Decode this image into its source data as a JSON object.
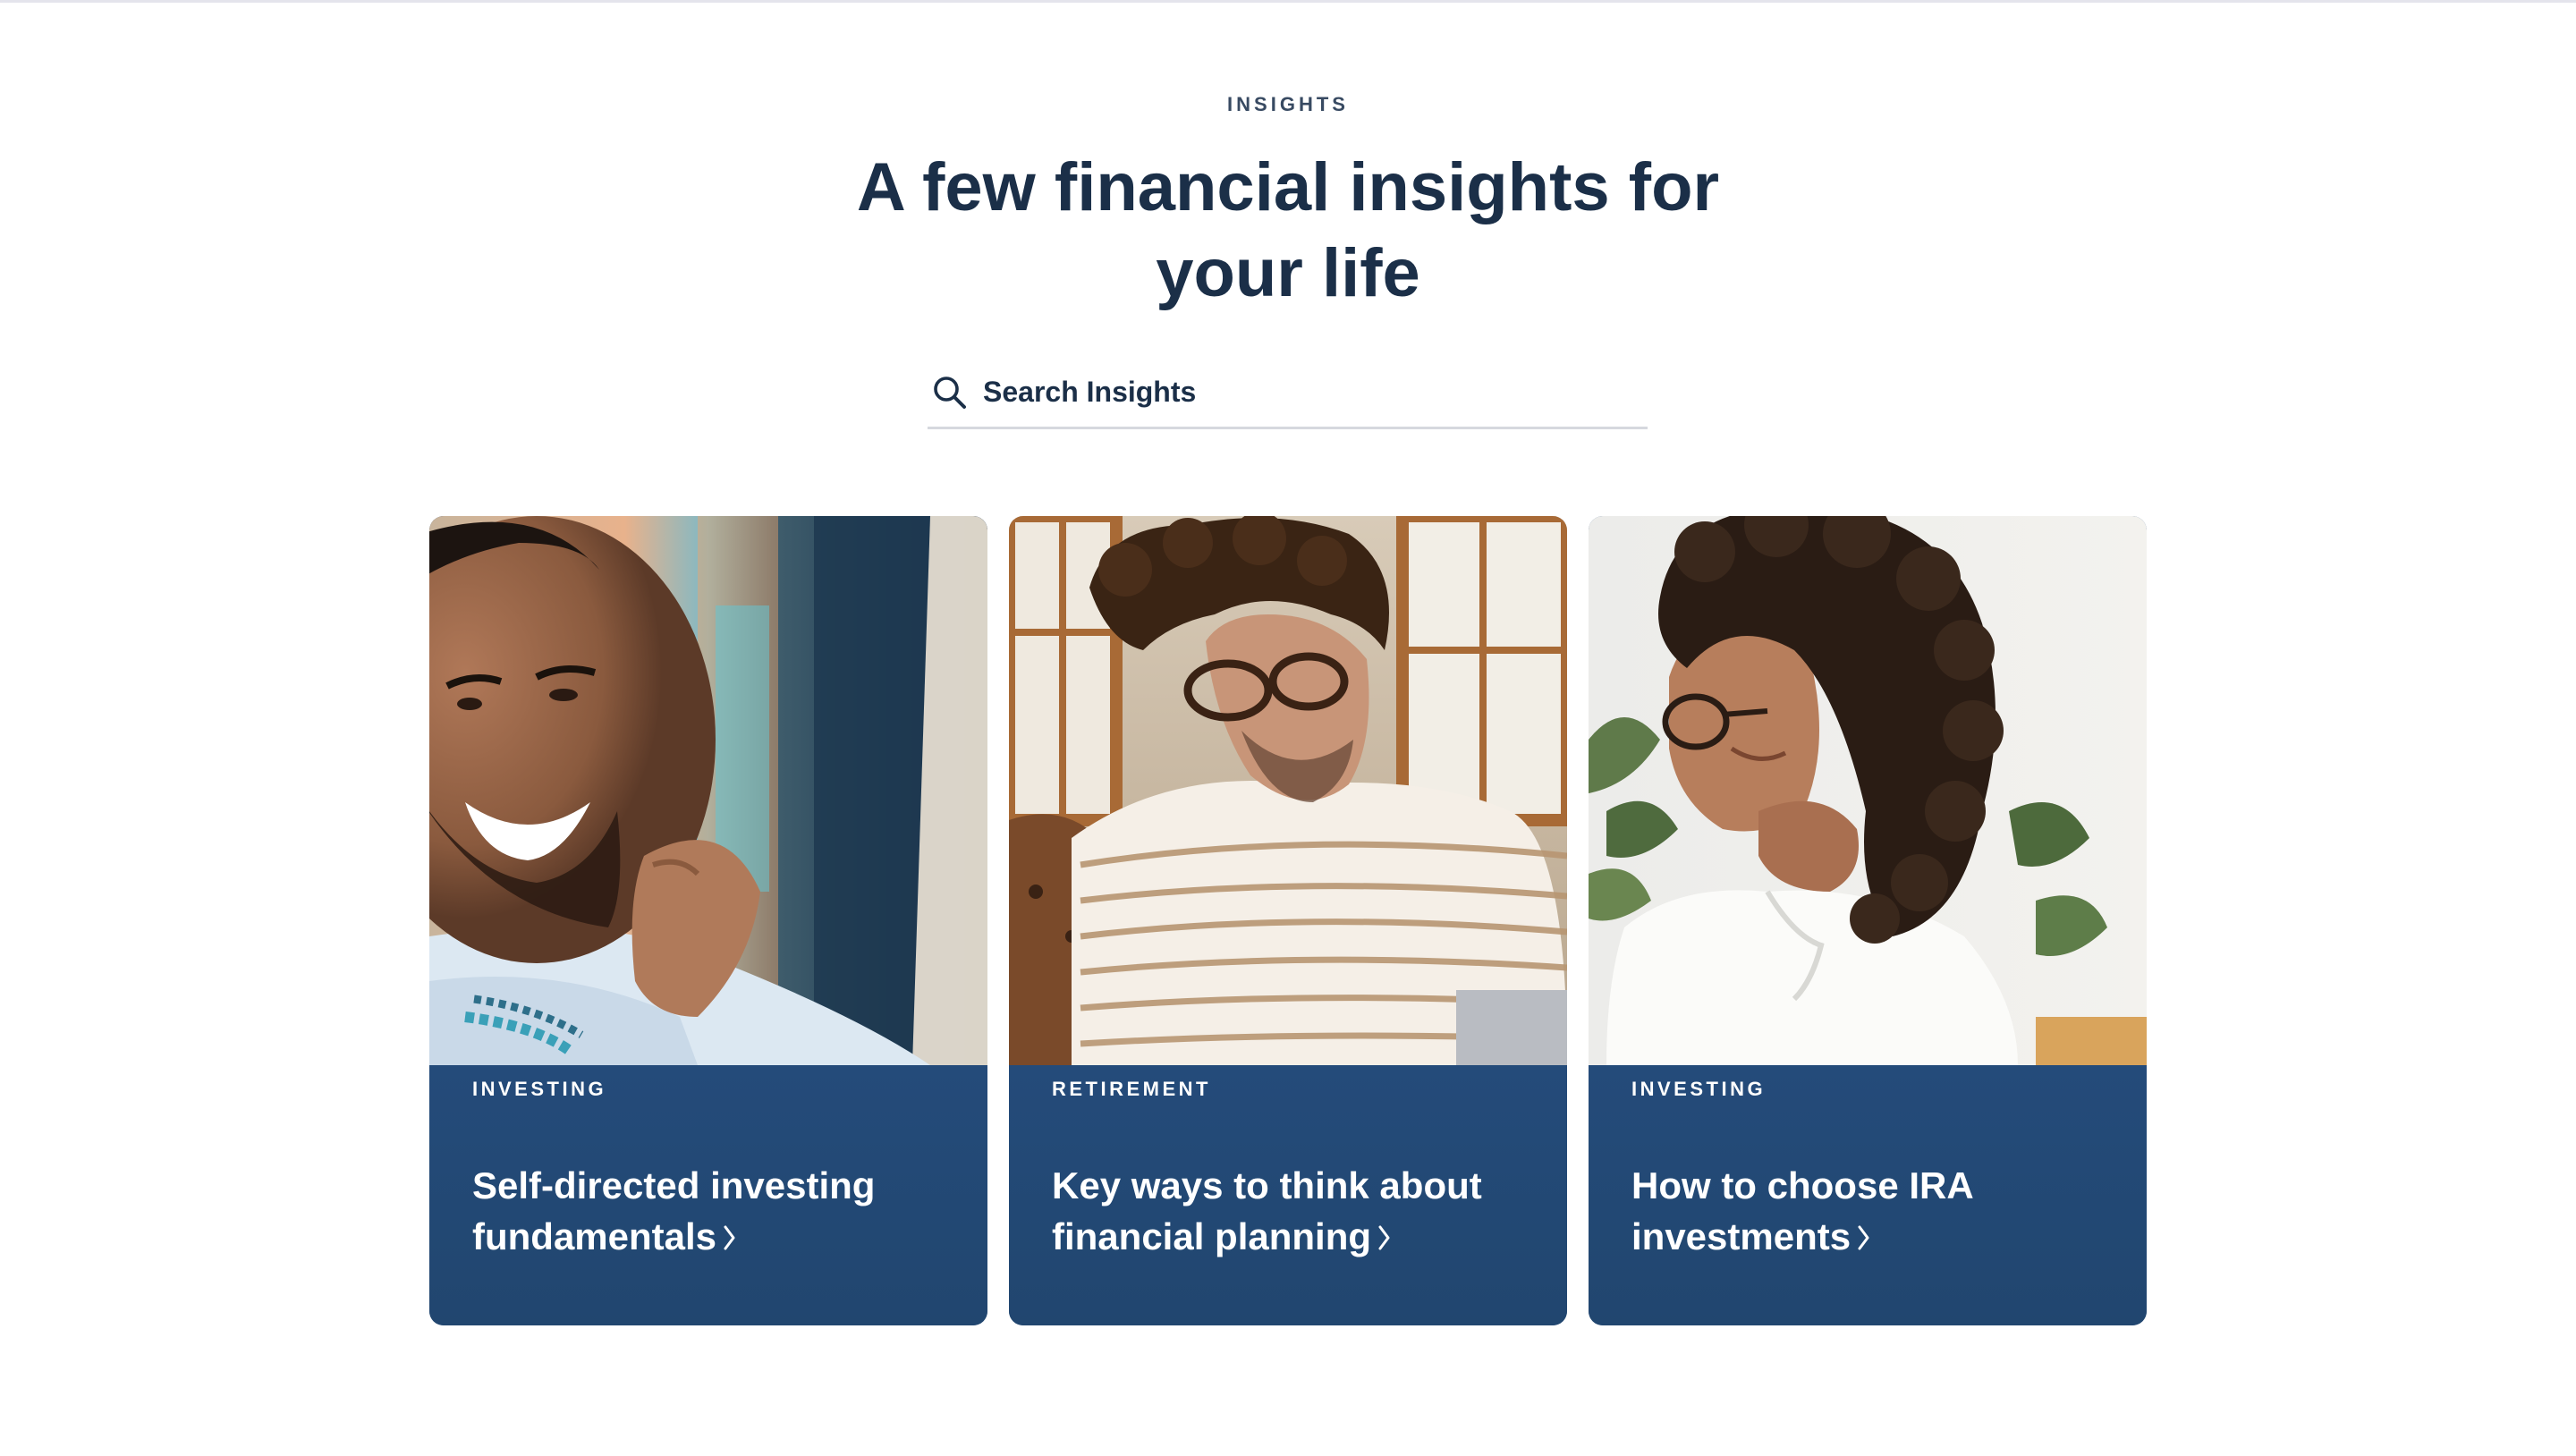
{
  "section": {
    "eyebrow": "INSIGHTS",
    "headline": "A few financial insights for your life"
  },
  "search": {
    "placeholder": "Search Insights",
    "icon": "search-icon"
  },
  "cards": [
    {
      "category": "INVESTING",
      "title": "Self-directed investing fundamentals",
      "image": "smiling-man-photo",
      "icon": "chevron-right-icon"
    },
    {
      "category": "RETIREMENT",
      "title": "Key ways to think about financial planning",
      "image": "man-with-glasses-reading-photo",
      "icon": "chevron-right-icon"
    },
    {
      "category": "INVESTING",
      "title": "How to choose IRA investments",
      "image": "woman-thinking-photo",
      "icon": "chevron-right-icon"
    }
  ],
  "colors": {
    "text_dark": "#1b2f48",
    "card_panel": "#234a78",
    "divider": "#d6d8de"
  }
}
